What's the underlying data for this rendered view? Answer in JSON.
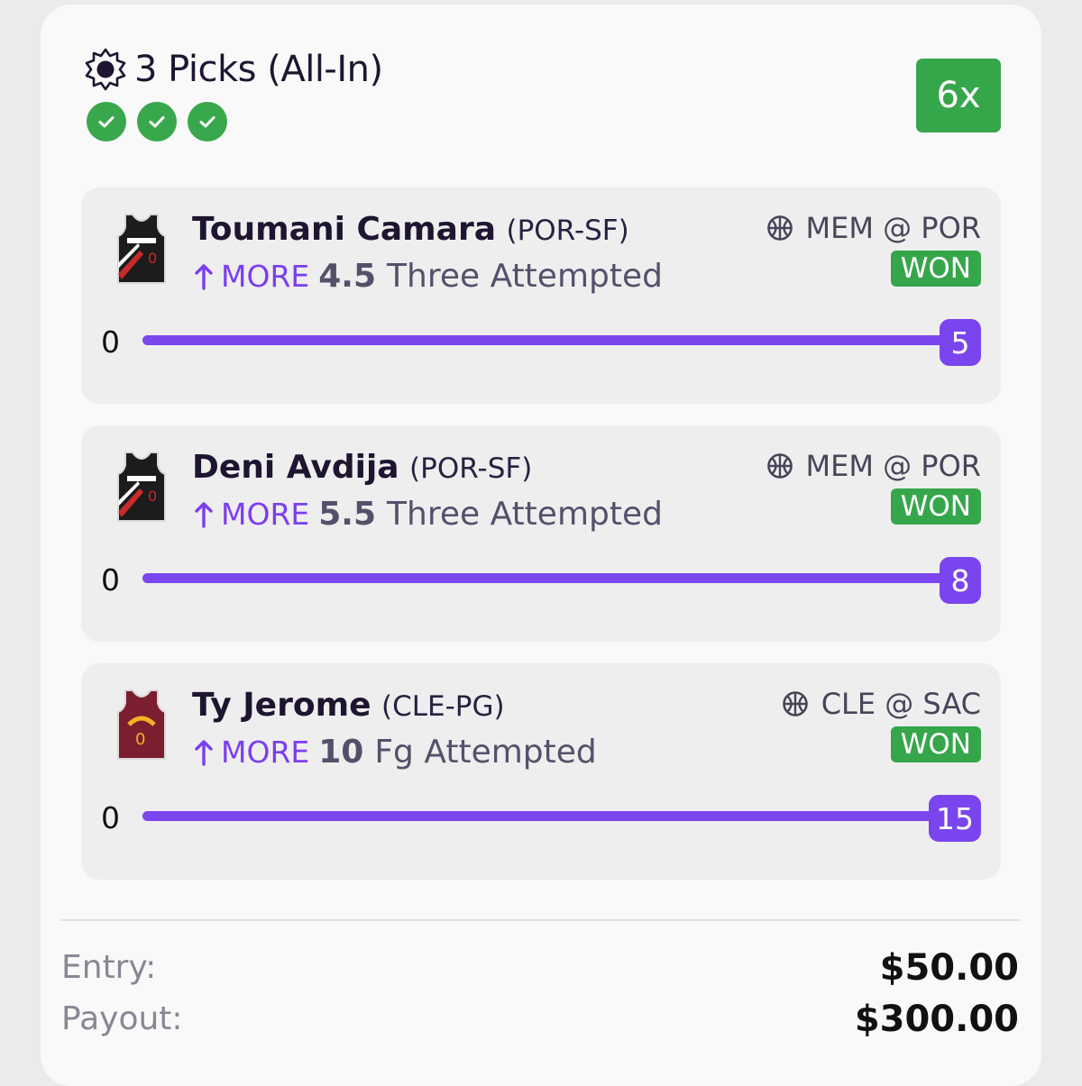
{
  "entry": {
    "title": "3 Picks (All-In)",
    "status_icons": [
      "check-icon",
      "check-icon",
      "check-icon"
    ],
    "multiplier": "6x",
    "colors": {
      "accent": "#7a45ee",
      "won": "#36a64b",
      "text": "#1e1530",
      "muted": "#8b8594"
    }
  },
  "picks": [
    {
      "name": "Toumani Camara",
      "position": "(POR-SF)",
      "jersey": "portland-jersey-icon",
      "direction": "MORE",
      "line": "4.5",
      "stat": "Three Attempted",
      "matchup": "MEM @ POR",
      "result": "WON",
      "min": "0",
      "actual": "5"
    },
    {
      "name": "Deni Avdija",
      "position": "(POR-SF)",
      "jersey": "portland-jersey-icon",
      "direction": "MORE",
      "line": "5.5",
      "stat": "Three Attempted",
      "matchup": "MEM @ POR",
      "result": "WON",
      "min": "0",
      "actual": "8"
    },
    {
      "name": "Ty Jerome",
      "position": "(CLE-PG)",
      "jersey": "cleveland-jersey-icon",
      "direction": "MORE",
      "line": "10",
      "stat": "Fg Attempted",
      "matchup": "CLE @ SAC",
      "result": "WON",
      "min": "0",
      "actual": "15"
    }
  ],
  "summary": {
    "entry_label": "Entry:",
    "entry_value": "$50.00",
    "payout_label": "Payout:",
    "payout_value": "$300.00"
  }
}
